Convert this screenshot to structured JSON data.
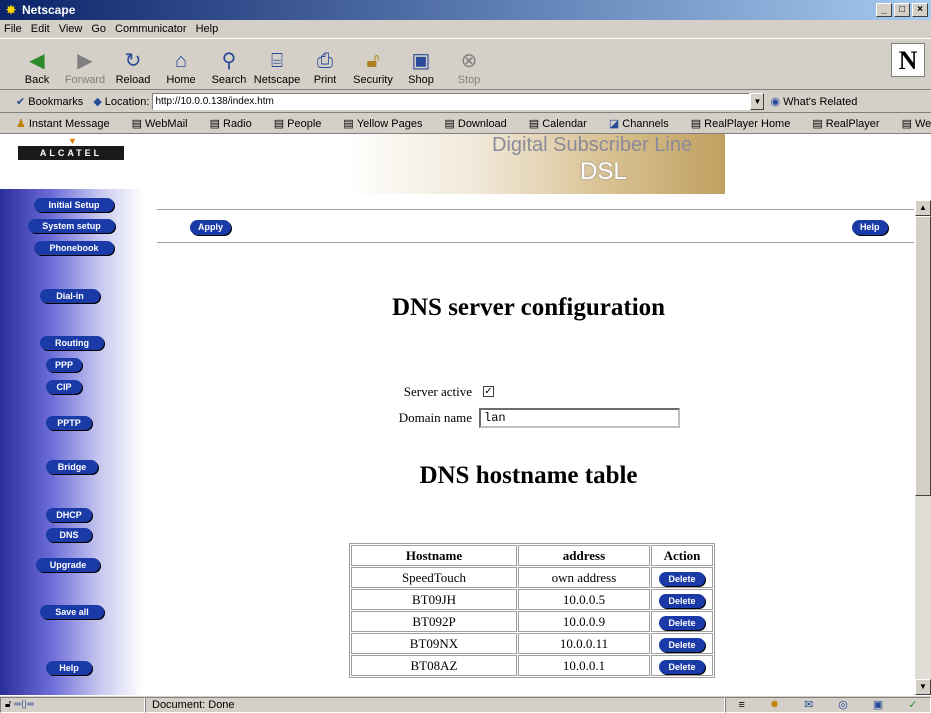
{
  "window": {
    "title": "Netscape",
    "icon": "netscape-star-icon"
  },
  "menu": [
    "File",
    "Edit",
    "View",
    "Go",
    "Communicator",
    "Help"
  ],
  "toolbar": {
    "buttons": [
      {
        "label": "Back",
        "icon": "back-arrow-icon"
      },
      {
        "label": "Forward",
        "icon": "forward-arrow-icon"
      },
      {
        "label": "Reload",
        "icon": "reload-icon"
      },
      {
        "label": "Home",
        "icon": "home-icon"
      },
      {
        "label": "Search",
        "icon": "search-icon"
      },
      {
        "label": "Netscape",
        "icon": "netscape-icon"
      },
      {
        "label": "Print",
        "icon": "print-icon"
      },
      {
        "label": "Security",
        "icon": "security-lock-icon"
      },
      {
        "label": "Shop",
        "icon": "shop-icon"
      },
      {
        "label": "Stop",
        "icon": "stop-icon"
      }
    ],
    "logo": "N"
  },
  "location": {
    "bookmarks_label": "Bookmarks",
    "location_label": "Location:",
    "url": "http://10.0.0.138/index.htm",
    "related_label": "What's Related"
  },
  "personal_toolbar": [
    "Instant Message",
    "WebMail",
    "Radio",
    "People",
    "Yellow Pages",
    "Download",
    "Calendar",
    "Channels",
    "RealPlayer Home",
    "RealPlayer",
    "Welcome to Liq"
  ],
  "page": {
    "brand": "ALCATEL",
    "banner_line1": "Digital Subscriber Line",
    "banner_line2": "DSL",
    "nav": [
      "Initial Setup",
      "System setup",
      "Phonebook",
      "Dial-in",
      "Routing",
      "PPP",
      "CIP",
      "PPTP",
      "Bridge",
      "DHCP",
      "DNS",
      "Upgrade",
      "Save all",
      "Help"
    ],
    "apply_label": "Apply",
    "help_label": "Help",
    "heading": "DNS server configuration",
    "server_active_label": "Server active",
    "server_active_checked": true,
    "domain_name_label": "Domain name",
    "domain_name_value": "lan",
    "table_heading": "DNS hostname table",
    "table": {
      "headers": [
        "Hostname",
        "address",
        "Action"
      ],
      "rows": [
        {
          "hostname": "SpeedTouch",
          "address": "own address",
          "action": "Delete"
        },
        {
          "hostname": "BT09JH",
          "address": "10.0.0.5",
          "action": "Delete"
        },
        {
          "hostname": "BT092P",
          "address": "10.0.0.9",
          "action": "Delete"
        },
        {
          "hostname": "BT09NX",
          "address": "10.0.0.11",
          "action": "Delete"
        },
        {
          "hostname": "BT08AZ",
          "address": "10.0.0.1",
          "action": "Delete"
        }
      ]
    }
  },
  "status": {
    "text": "Document: Done"
  }
}
